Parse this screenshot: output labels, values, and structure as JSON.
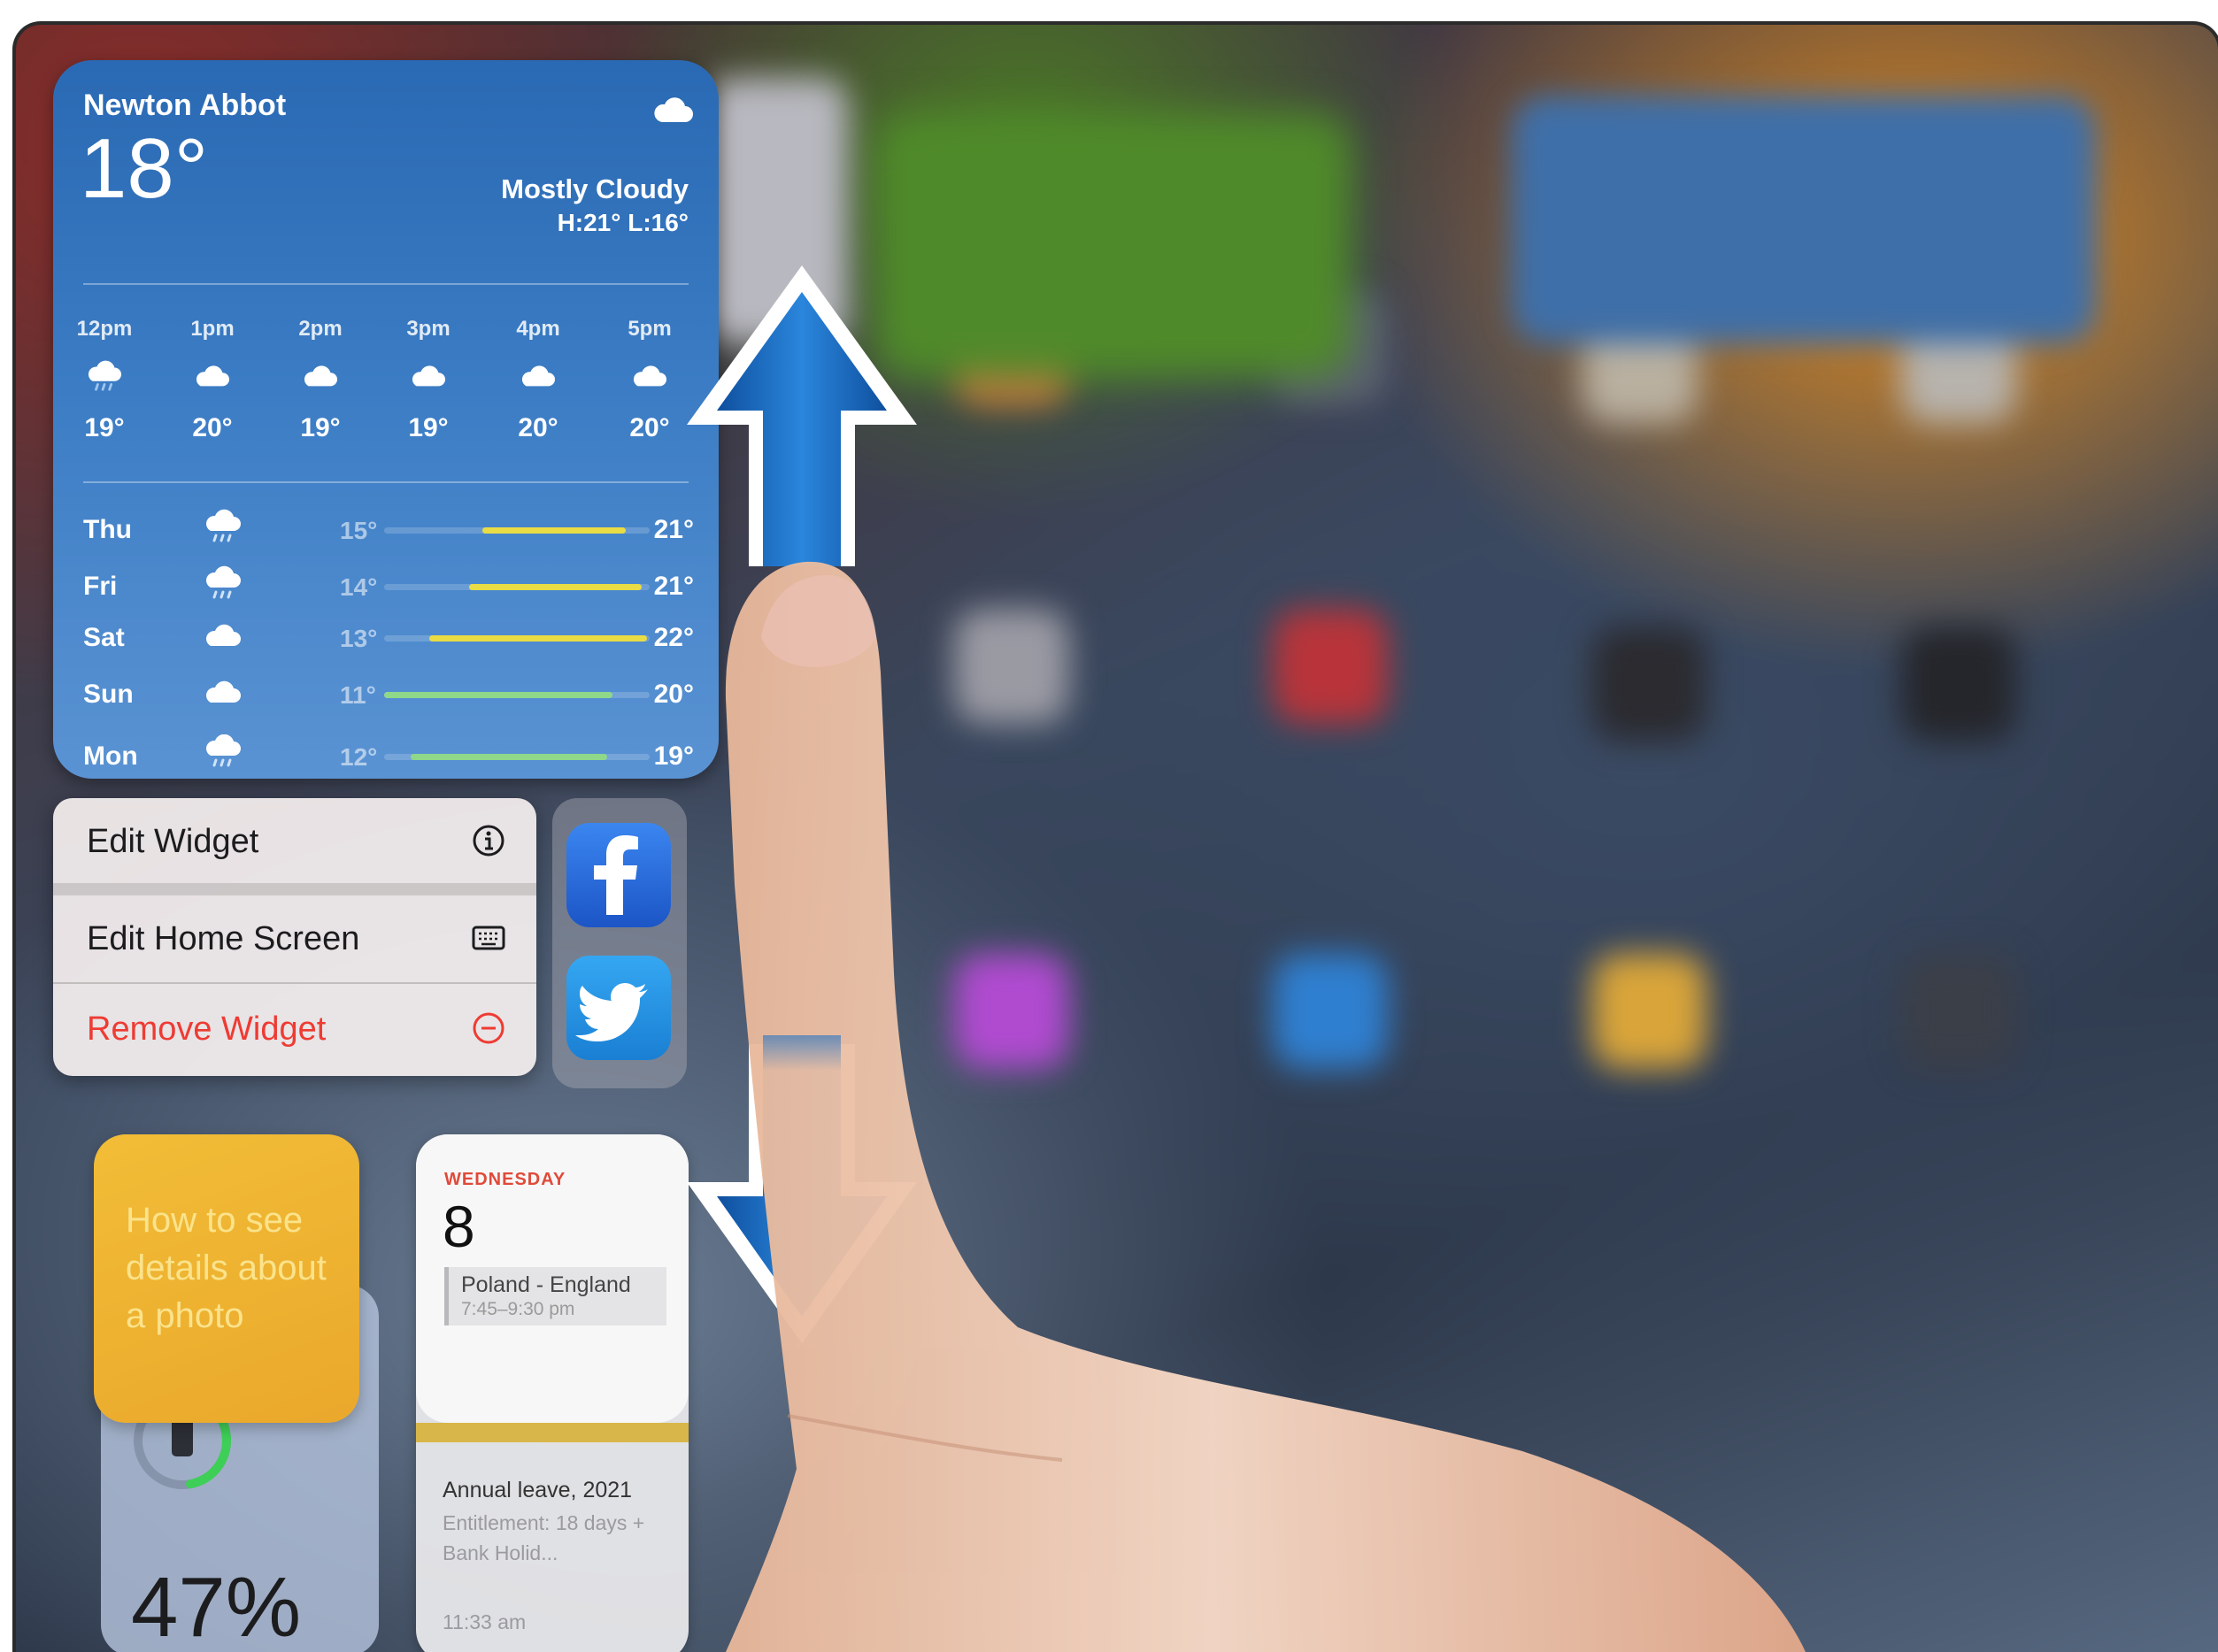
{
  "weather": {
    "location": "Newton Abbot",
    "temperature": "18°",
    "condition": "Mostly Cloudy",
    "high_low": "H:21° L:16°",
    "hourly": [
      {
        "time": "12pm",
        "icon": "cloud-rain-icon",
        "temp": "19°"
      },
      {
        "time": "1pm",
        "icon": "cloud-icon",
        "temp": "20°"
      },
      {
        "time": "2pm",
        "icon": "cloud-icon",
        "temp": "19°"
      },
      {
        "time": "3pm",
        "icon": "cloud-icon",
        "temp": "19°"
      },
      {
        "time": "4pm",
        "icon": "cloud-icon",
        "temp": "20°"
      },
      {
        "time": "5pm",
        "icon": "cloud-icon",
        "temp": "20°"
      }
    ],
    "daily": [
      {
        "day": "Thu",
        "icon": "cloud-rain-icon",
        "low": "15°",
        "high": "21°",
        "range": [
          0.37,
          0.91
        ],
        "color": "#e9dc44"
      },
      {
        "day": "Fri",
        "icon": "cloud-rain-icon",
        "low": "14°",
        "high": "21°",
        "range": [
          0.32,
          0.97
        ],
        "color": "#e9dc44"
      },
      {
        "day": "Sat",
        "icon": "cloud-icon",
        "low": "13°",
        "high": "22°",
        "range": [
          0.17,
          0.99
        ],
        "color": "#e9dc44"
      },
      {
        "day": "Sun",
        "icon": "cloud-icon",
        "low": "11°",
        "high": "20°",
        "range": [
          0.0,
          0.86
        ],
        "color": "#8fd88a"
      },
      {
        "day": "Mon",
        "icon": "cloud-rain-icon",
        "low": "12°",
        "high": "19°",
        "range": [
          0.1,
          0.84
        ],
        "color": "#8fd88a"
      }
    ]
  },
  "menu": {
    "edit_widget": "Edit Widget",
    "edit_home_screen": "Edit Home Screen",
    "remove_widget": "Remove Widget"
  },
  "apps": {
    "facebook_icon": "f",
    "twitter_icon": "twitter-bird-icon"
  },
  "note_widget": {
    "text": "How to see details about a photo"
  },
  "battery_widget": {
    "percent": "47%",
    "level": 0.47
  },
  "calendar_widget": {
    "weekday": "WEDNESDAY",
    "date": "8",
    "event_title": "Poland - England",
    "event_time": "7:45–9:30 pm",
    "reminder_title": "Annual leave, 2021",
    "reminder_detail": "Entitlement: 18 days + Bank Holid...",
    "reminder_time": "11:33 am"
  },
  "colors": {
    "weather_blue": "#2a69b3",
    "remove_red": "#ee3b33",
    "facebook_blue": "#1f63d6",
    "twitter_blue": "#1f8fe0",
    "note_yellow": "#f2bd37",
    "arrow_blue": "#1c6fc4"
  }
}
